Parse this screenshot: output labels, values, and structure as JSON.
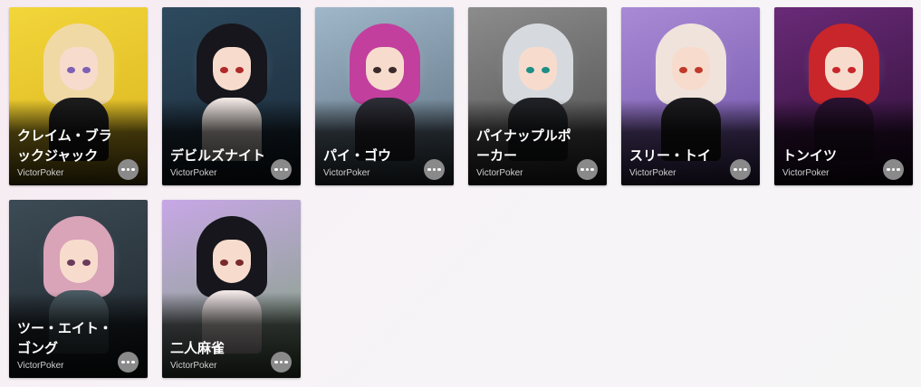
{
  "games": [
    {
      "title": "クレイム・ブラックジャック",
      "provider": "VictorPoker",
      "icon": "ace-of-spades-card-icon",
      "colors": {
        "bg1": "#f2d63a",
        "bg2": "#d9b21c",
        "hair": "#f1d9a6",
        "eye": "#7e5fb5",
        "outfit": "#1c1c1c"
      }
    },
    {
      "title": "デビルズナイト",
      "provider": "VictorPoker",
      "icon": "sword-icon",
      "colors": {
        "bg1": "#2e4a5e",
        "bg2": "#1a2a38",
        "hair": "#16161c",
        "eye": "#b02a2a",
        "outfit": "#efe6e2"
      }
    },
    {
      "title": "パイ・ゴウ",
      "provider": "VictorPoker",
      "icon": "basketball-icon",
      "colors": {
        "bg1": "#9fb7c9",
        "bg2": "#5b6e7e",
        "hair": "#c23f9e",
        "eye": "#3a2a2a",
        "outfit": "#2d2d36"
      }
    },
    {
      "title": "パイナップルポーカー",
      "provider": "VictorPoker",
      "icon": "rifle-icon",
      "colors": {
        "bg1": "#8c8c8c",
        "bg2": "#4a4a4a",
        "hair": "#d6dadf",
        "eye": "#1d8f86",
        "outfit": "#202226"
      }
    },
    {
      "title": "スリー・トイ",
      "provider": "VictorPoker",
      "icon": "water-pistol-icon",
      "colors": {
        "bg1": "#a98ad6",
        "bg2": "#6f52a8",
        "hair": "#efe3dc",
        "eye": "#c0392b",
        "outfit": "#1b1b1f"
      }
    },
    {
      "title": "トンイツ",
      "provider": "VictorPoker",
      "icon": "playing-cards-icon",
      "colors": {
        "bg1": "#6a2a78",
        "bg2": "#2b0f33",
        "hair": "#c8262b",
        "eye": "#c8262b",
        "outfit": "#2a1230"
      }
    },
    {
      "title": "ツー・エイト・ゴング",
      "provider": "VictorPoker",
      "icon": "mahjong-tile-icon",
      "colors": {
        "bg1": "#3c4b55",
        "bg2": "#1e252b",
        "hair": "#d9a3b8",
        "eye": "#6b3b5b",
        "outfit": "#4a5a62"
      }
    },
    {
      "title": "二人麻雀",
      "provider": "VictorPoker",
      "icon": "butterfly-icon",
      "colors": {
        "bg1": "#c7a7e6",
        "bg2": "#7ea27a",
        "hair": "#16161c",
        "eye": "#7a2a2a",
        "outfit": "#f0e6e6"
      }
    }
  ],
  "more_button_icon": "more-horizontal-icon"
}
